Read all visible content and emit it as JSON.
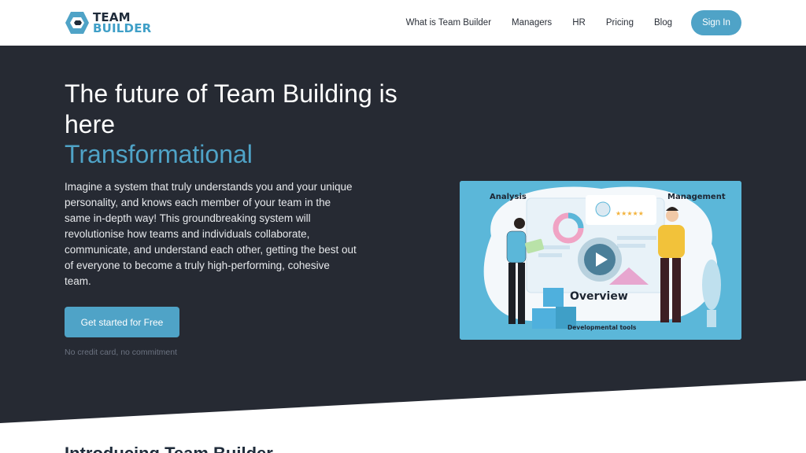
{
  "brand": {
    "line1": "TEAM",
    "line2": "BUILDER",
    "primary": "#4fa3c7",
    "dark": "#262a33"
  },
  "nav": {
    "items": [
      {
        "label": "What is Team Builder"
      },
      {
        "label": "Managers"
      },
      {
        "label": "HR"
      },
      {
        "label": "Pricing"
      },
      {
        "label": "Blog"
      }
    ],
    "signin_label": "Sign In"
  },
  "hero": {
    "title": "The future of Team Building is here",
    "accent": "Transformational",
    "description": "Imagine a system that truly understands you and your unique personality, and knows each member of your team in the same in-depth way! This groundbreaking system will revolutionise how teams and individuals collaborate, communicate, and understand each other, getting the best out of everyone to become a truly high-performing, cohesive team.",
    "cta_label": "Get started for Free",
    "cta_note": "No credit card, no commitment"
  },
  "illustration": {
    "analysis": "Analysis",
    "management": "Management",
    "overview": "Overview",
    "dev_tools": "Developmental tools",
    "stars": "★★★★★"
  },
  "intro": {
    "title": "Introducing Team Builder"
  }
}
